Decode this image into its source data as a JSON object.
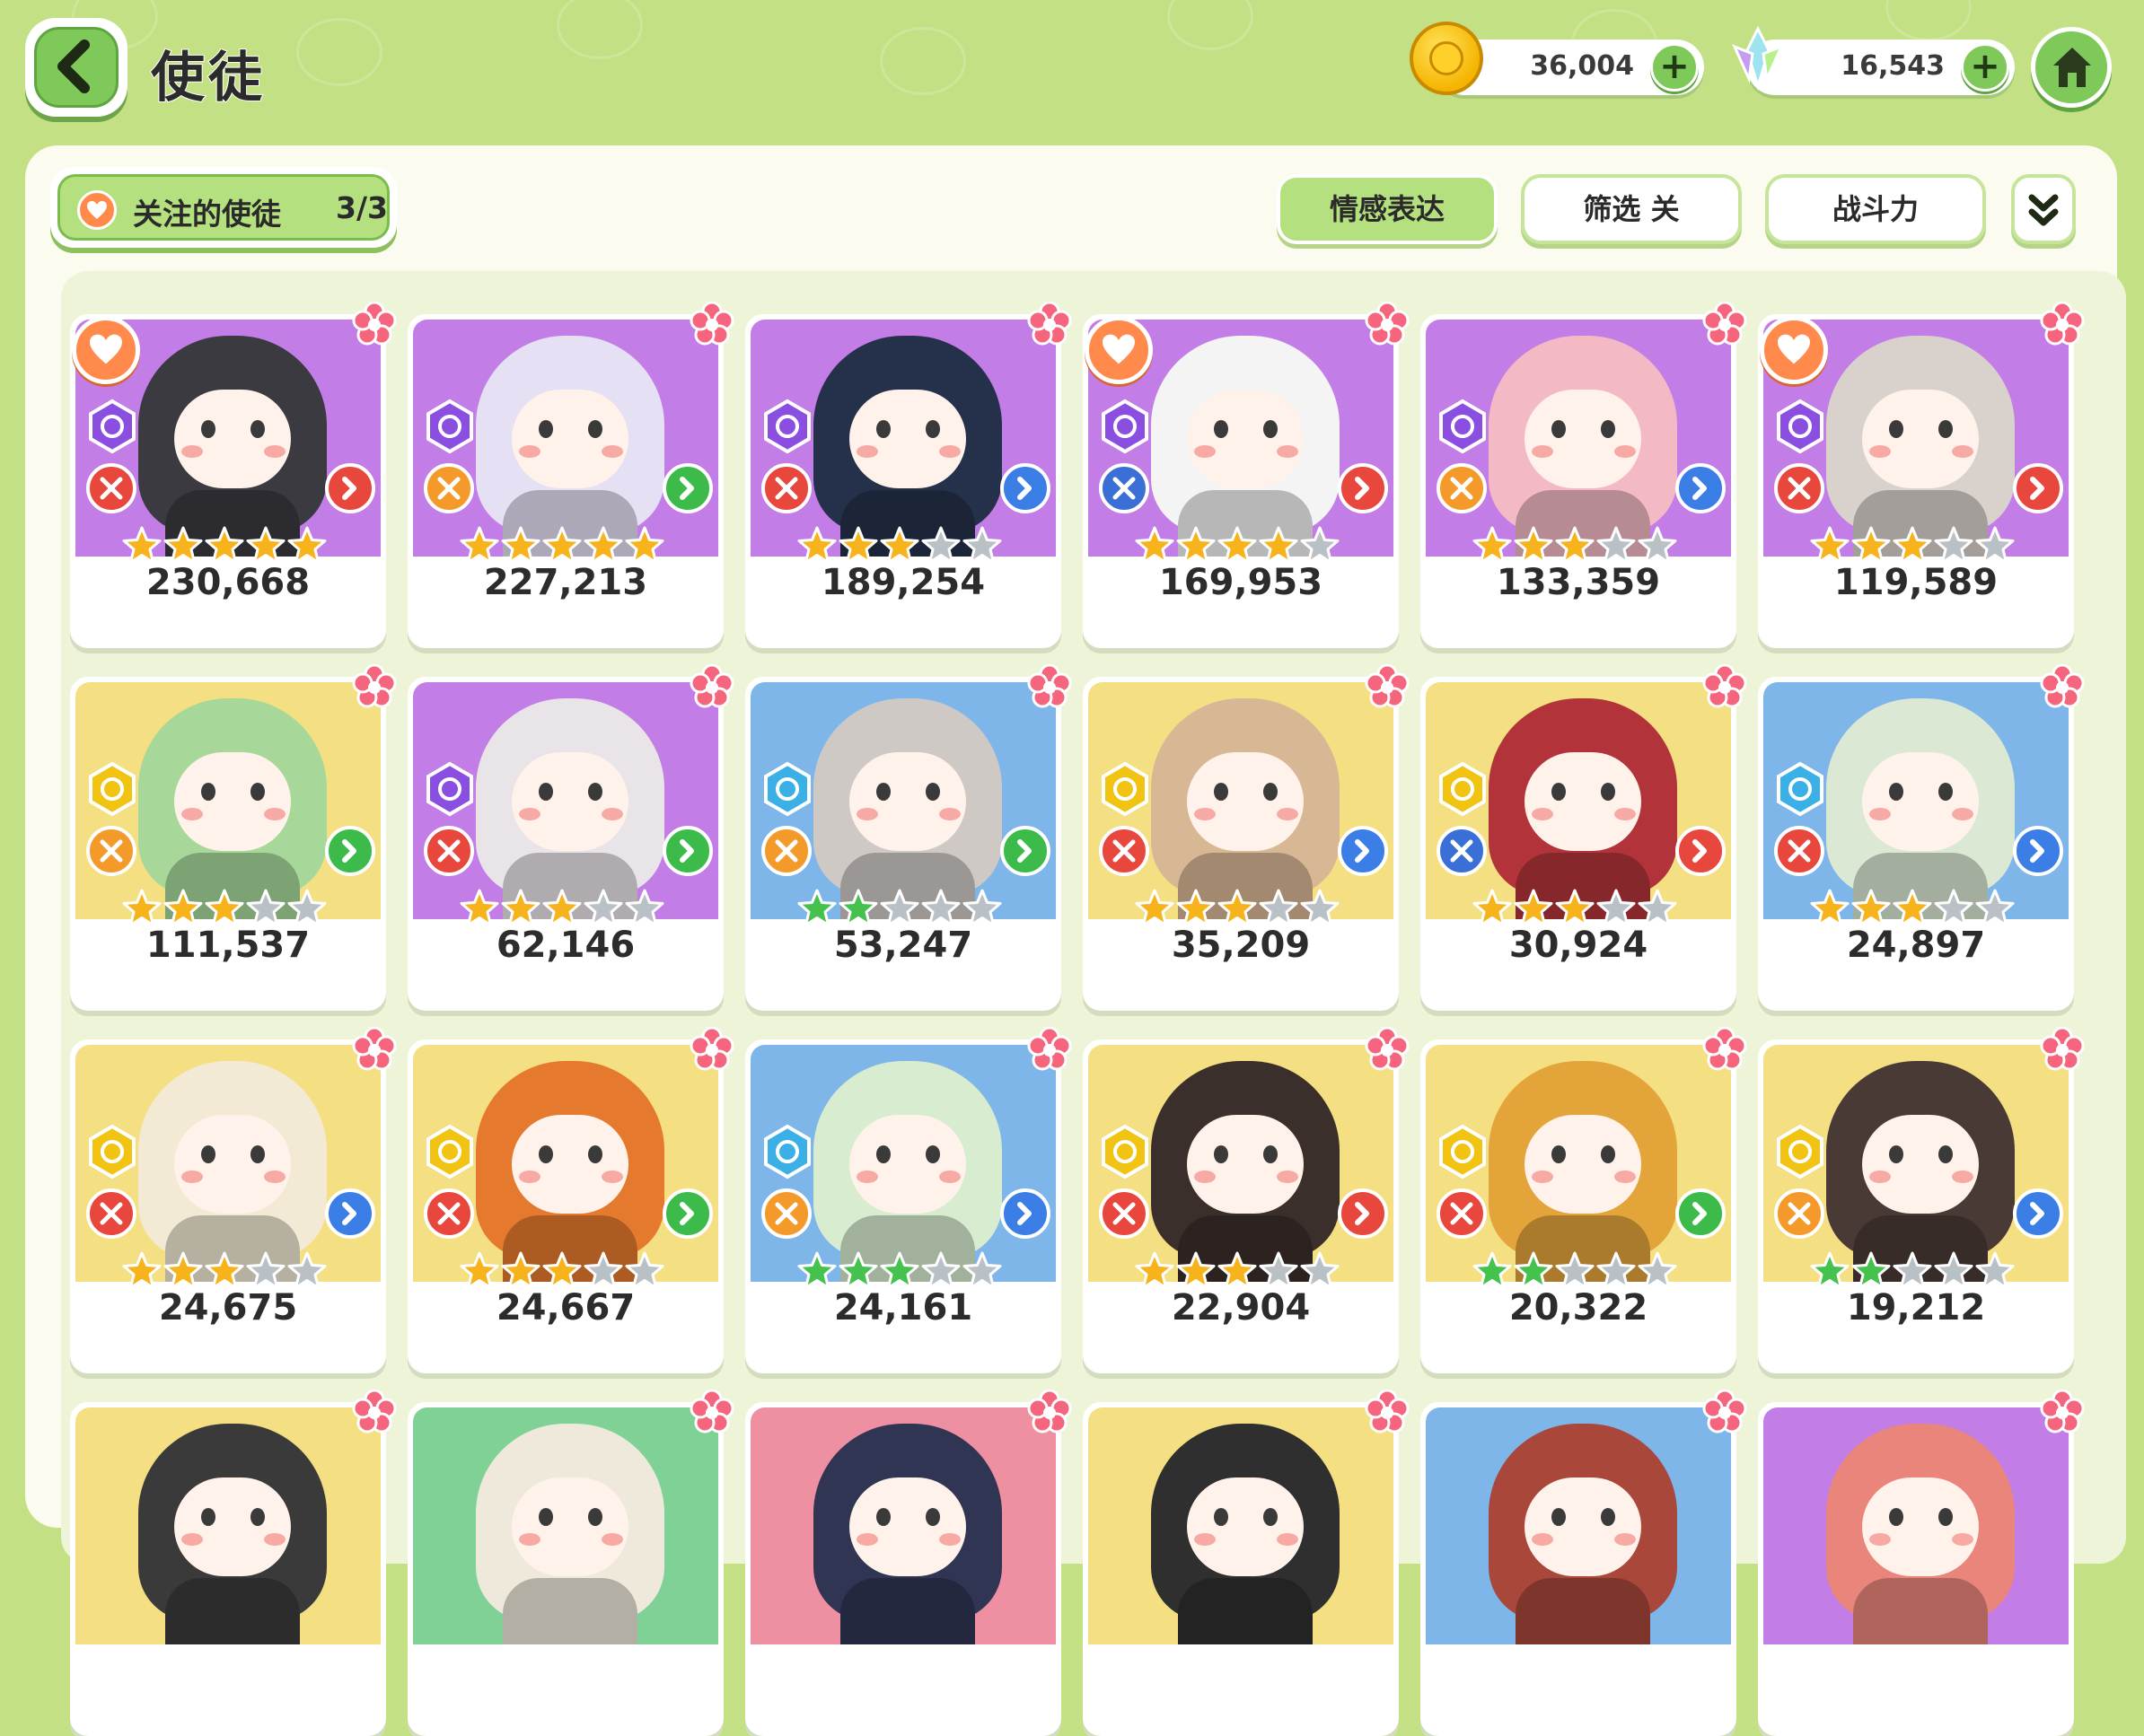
{
  "header": {
    "title": "使徒",
    "gold_amount": "36,004",
    "gem_amount": "16,543"
  },
  "toolbar": {
    "favorites_label": "关注的使徒",
    "favorites_count": "3/3",
    "emotion_label": "情感表达",
    "filter_label": "筛选 关",
    "power_label": "战斗力"
  },
  "colors": {
    "background": "#c3e184",
    "accent_green": "#7ec95a",
    "favorite_orange": "#ff8a4c",
    "card_purple": "#c37de6",
    "card_yellow": "#f4df83",
    "card_blue": "#7fb6ea",
    "star_gold": "#f7b31c",
    "star_green": "#3cc04a"
  },
  "cards": [
    {
      "power": "230,668",
      "bg": "purple",
      "hair": "#3a3a40",
      "favorite": true,
      "element": "spiral",
      "role": "sword",
      "arrow": "red",
      "stars": 5,
      "star_color": "gold"
    },
    {
      "power": "227,213",
      "bg": "purple",
      "hair": "#e6e0f4",
      "favorite": false,
      "element": "spiral",
      "role": "heal",
      "arrow": "green",
      "stars": 5,
      "star_color": "gold"
    },
    {
      "power": "189,254",
      "bg": "purple",
      "hair": "#25304a",
      "favorite": false,
      "element": "spiral",
      "role": "sword",
      "arrow": "blue",
      "stars": 3,
      "star_color": "gold"
    },
    {
      "power": "169,953",
      "bg": "purple",
      "hair": "#f4f4f4",
      "favorite": true,
      "element": "spiral",
      "role": "shield",
      "arrow": "red",
      "stars": 4,
      "star_color": "gold"
    },
    {
      "power": "133,359",
      "bg": "purple",
      "hair": "#f3b9c4",
      "favorite": false,
      "element": "spiral",
      "role": "heal",
      "arrow": "blue",
      "stars": 3,
      "star_color": "gold"
    },
    {
      "power": "119,589",
      "bg": "purple",
      "hair": "#d9d2cc",
      "favorite": true,
      "element": "spiral",
      "role": "sword",
      "arrow": "red",
      "stars": 3,
      "star_color": "gold"
    },
    {
      "power": "111,537",
      "bg": "yellow",
      "hair": "#a7d89a",
      "favorite": false,
      "element": "sun",
      "role": "heal",
      "arrow": "green",
      "stars": 3,
      "star_color": "gold"
    },
    {
      "power": "62,146",
      "bg": "purple",
      "hair": "#e9e4e8",
      "favorite": false,
      "element": "spiral",
      "role": "sword",
      "arrow": "green",
      "stars": 3,
      "star_color": "gold"
    },
    {
      "power": "53,247",
      "bg": "blue",
      "hair": "#cfc9c6",
      "favorite": false,
      "element": "snow",
      "role": "heal",
      "arrow": "green",
      "stars": 2,
      "star_color": "green"
    },
    {
      "power": "35,209",
      "bg": "yellow",
      "hair": "#d8b795",
      "favorite": false,
      "element": "sun",
      "role": "sword",
      "arrow": "blue",
      "stars": 3,
      "star_color": "gold"
    },
    {
      "power": "30,924",
      "bg": "yellow",
      "hair": "#b2343a",
      "favorite": false,
      "element": "sun",
      "role": "shield",
      "arrow": "red",
      "stars": 3,
      "star_color": "gold"
    },
    {
      "power": "24,897",
      "bg": "blue",
      "hair": "#dbe8d4",
      "favorite": false,
      "element": "snow",
      "role": "sword",
      "arrow": "blue",
      "stars": 3,
      "star_color": "gold"
    },
    {
      "power": "24,675",
      "bg": "yellow",
      "hair": "#f3ead5",
      "favorite": false,
      "element": "sun",
      "role": "sword",
      "arrow": "blue",
      "stars": 3,
      "star_color": "gold"
    },
    {
      "power": "24,667",
      "bg": "yellow",
      "hair": "#e57a2f",
      "favorite": false,
      "element": "sun",
      "role": "sword",
      "arrow": "green",
      "stars": 3,
      "star_color": "gold"
    },
    {
      "power": "24,161",
      "bg": "blue",
      "hair": "#d8ecd0",
      "favorite": false,
      "element": "snow",
      "role": "heal",
      "arrow": "blue",
      "stars": 3,
      "star_color": "green"
    },
    {
      "power": "22,904",
      "bg": "yellow",
      "hair": "#3a2f2a",
      "favorite": false,
      "element": "sun",
      "role": "sword",
      "arrow": "red",
      "stars": 3,
      "star_color": "gold"
    },
    {
      "power": "20,322",
      "bg": "yellow",
      "hair": "#e3a43a",
      "favorite": false,
      "element": "sun",
      "role": "sword",
      "arrow": "green",
      "stars": 2,
      "star_color": "green"
    },
    {
      "power": "19,212",
      "bg": "yellow",
      "hair": "#4a3a36",
      "favorite": false,
      "element": "sun",
      "role": "heal",
      "arrow": "blue",
      "stars": 2,
      "star_color": "green"
    },
    {
      "power": "",
      "bg": "yellow",
      "hair": "#3a3a3a",
      "favorite": false,
      "element": "sun",
      "role": "sword",
      "arrow": "red",
      "stars": 0,
      "star_color": "gold"
    },
    {
      "power": "",
      "bg": "green",
      "hair": "#efe9dc",
      "favorite": false,
      "element": "sun",
      "role": "sword",
      "arrow": "red",
      "stars": 0,
      "star_color": "gold"
    },
    {
      "power": "",
      "bg": "pink",
      "hair": "#2f3552",
      "favorite": false,
      "element": "sun",
      "role": "sword",
      "arrow": "red",
      "stars": 0,
      "star_color": "gold"
    },
    {
      "power": "",
      "bg": "yellow",
      "hair": "#2f2f2f",
      "favorite": false,
      "element": "sun",
      "role": "sword",
      "arrow": "red",
      "stars": 0,
      "star_color": "gold"
    },
    {
      "power": "",
      "bg": "blue",
      "hair": "#a8473a",
      "favorite": false,
      "element": "sun",
      "role": "sword",
      "arrow": "red",
      "stars": 0,
      "star_color": "gold"
    },
    {
      "power": "",
      "bg": "purple",
      "hair": "#e9857a",
      "favorite": false,
      "element": "sun",
      "role": "sword",
      "arrow": "red",
      "stars": 0,
      "star_color": "gold"
    }
  ]
}
